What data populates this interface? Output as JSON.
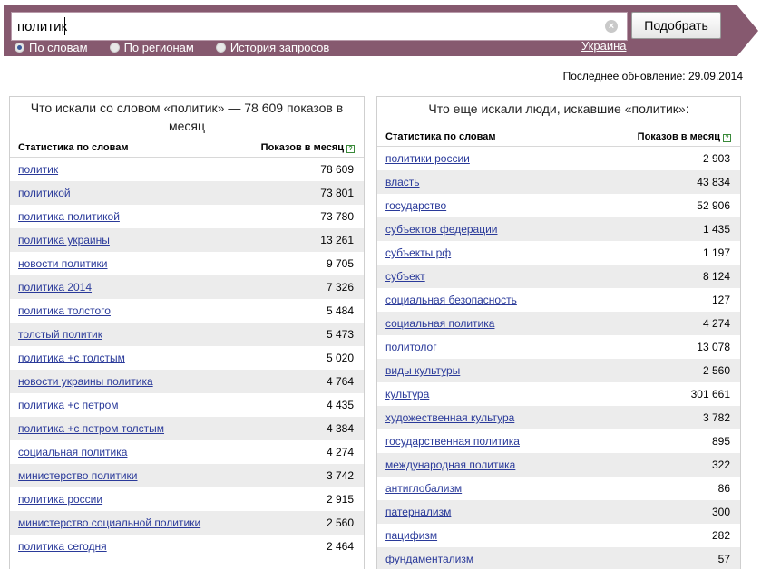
{
  "search": {
    "query": "политик",
    "clear_glyph": "×",
    "submit_label": "Подобрать",
    "modes": [
      {
        "label": "По словам",
        "checked": true
      },
      {
        "label": "По регионам",
        "checked": false
      },
      {
        "label": "История запросов",
        "checked": false
      }
    ],
    "region": "Украина"
  },
  "updated": "Последнее обновление: 29.09.2014",
  "left_panel": {
    "title": "Что искали со словом «политик» — 78 609 показов в месяц",
    "col_word": "Статистика по словам",
    "col_count": "Показов в месяц",
    "help": "?",
    "rows": [
      {
        "word": "политик",
        "count": "78 609"
      },
      {
        "word": "политикой",
        "count": "73 801"
      },
      {
        "word": "политика политикой",
        "count": "73 780"
      },
      {
        "word": "политика украины",
        "count": "13 261"
      },
      {
        "word": "новости политики",
        "count": "9 705"
      },
      {
        "word": "политика 2014",
        "count": "7 326"
      },
      {
        "word": "политика толстого",
        "count": "5 484"
      },
      {
        "word": "толстый политик",
        "count": "5 473"
      },
      {
        "word": "политика +с толстым",
        "count": "5 020"
      },
      {
        "word": "новости украины политика",
        "count": "4 764"
      },
      {
        "word": "политика +с петром",
        "count": "4 435"
      },
      {
        "word": "политика +с петром толстым",
        "count": "4 384"
      },
      {
        "word": "социальная политика",
        "count": "4 274"
      },
      {
        "word": "министерство политики",
        "count": "3 742"
      },
      {
        "word": "политика россии",
        "count": "2 915"
      },
      {
        "word": "министерство социальной политики",
        "count": "2 560"
      },
      {
        "word": "политика сегодня",
        "count": "2 464"
      }
    ]
  },
  "right_panel": {
    "title": "Что еще искали люди, искавшие «политик»:",
    "col_word": "Статистика по словам",
    "col_count": "Показов в месяц",
    "help": "?",
    "rows": [
      {
        "word": "политики россии",
        "count": "2 903"
      },
      {
        "word": "власть",
        "count": "43 834"
      },
      {
        "word": "государство",
        "count": "52 906"
      },
      {
        "word": "субъектов федерации",
        "count": "1 435"
      },
      {
        "word": "субъекты рф",
        "count": "1 197"
      },
      {
        "word": "субъект",
        "count": "8 124"
      },
      {
        "word": "социальная безопасность",
        "count": "127"
      },
      {
        "word": "социальная политика",
        "count": "4 274"
      },
      {
        "word": "политолог",
        "count": "13 078"
      },
      {
        "word": "виды культуры",
        "count": "2 560"
      },
      {
        "word": "культура",
        "count": "301 661"
      },
      {
        "word": "художественная культура",
        "count": "3 782"
      },
      {
        "word": "государственная политика",
        "count": "895"
      },
      {
        "word": "международная политика",
        "count": "322"
      },
      {
        "word": "антиглобализм",
        "count": "86"
      },
      {
        "word": "патернализм",
        "count": "300"
      },
      {
        "word": "пацифизм",
        "count": "282"
      },
      {
        "word": "фундаментализм",
        "count": "57"
      }
    ]
  }
}
